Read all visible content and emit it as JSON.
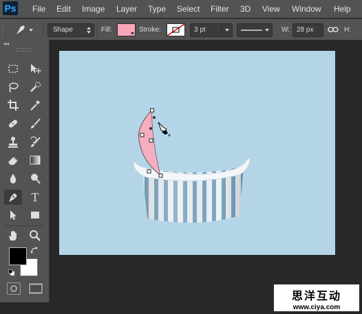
{
  "app": {
    "logo": "Ps"
  },
  "menu": [
    "File",
    "Edit",
    "Image",
    "Layer",
    "Type",
    "Select",
    "Filter",
    "3D",
    "View",
    "Window",
    "Help"
  ],
  "options": {
    "tool_icon": "pen-icon",
    "mode": "Shape",
    "fill_label": "Fill:",
    "fill_color": "#f6a6b8",
    "stroke_label": "Stroke:",
    "stroke_width": "3 pt",
    "width_label": "W:",
    "width_value": "28 px",
    "height_label": "H:"
  },
  "toolbar": {
    "collapse": "◂◂",
    "tools": [
      "marquee-icon",
      "move-icon",
      "lasso-icon",
      "quick-select-icon",
      "crop-icon",
      "eyedropper-icon",
      "healing-icon",
      "brush-icon",
      "stamp-icon",
      "history-brush-icon",
      "eraser-icon",
      "gradient-icon",
      "blur-icon",
      "dodge-icon",
      "pen-icon",
      "type-icon",
      "path-select-icon",
      "rectangle-icon",
      "hand-icon",
      "zoom-icon"
    ],
    "type_glyph": "T",
    "active_tool": "pen-icon",
    "foreground_color": "#000000",
    "background_color": "#ffffff"
  },
  "canvas": {
    "background": "#b3d5e7"
  },
  "watermark": {
    "line1": "思洋互动",
    "line2": "www.ciya.com"
  }
}
